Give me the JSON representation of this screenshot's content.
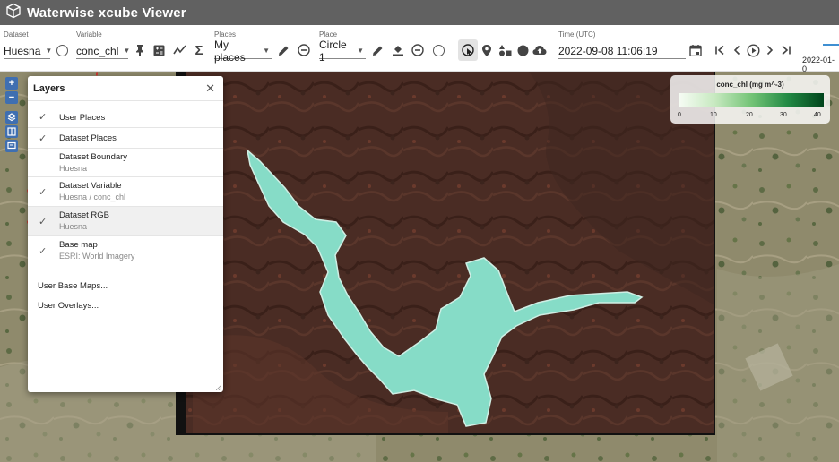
{
  "app": {
    "title": "Waterwise xcube Viewer"
  },
  "toolbar": {
    "dataset": {
      "label": "Dataset",
      "value": "Huesna"
    },
    "variable": {
      "label": "Variable",
      "value": "conc_chl"
    },
    "places": {
      "label": "Places",
      "value": "My places"
    },
    "place": {
      "label": "Place",
      "value": "Circle 1"
    },
    "time": {
      "label": "Time (UTC)",
      "value": "2022-09-08 11:06:19"
    },
    "timeline_start": "2022-01-0"
  },
  "layers_panel": {
    "title": "Layers",
    "items": [
      {
        "label": "User Places",
        "sub": "",
        "checked": true
      },
      {
        "label": "Dataset Places",
        "sub": "",
        "checked": true
      },
      {
        "label": "Dataset Boundary",
        "sub": "Huesna",
        "checked": false
      },
      {
        "label": "Dataset Variable",
        "sub": "Huesna / conc_chl",
        "checked": true
      },
      {
        "label": "Dataset RGB",
        "sub": "Huesna",
        "checked": true
      },
      {
        "label": "Base map",
        "sub": "ESRI: World Imagery",
        "checked": true
      }
    ],
    "links": [
      "User Base Maps...",
      "User Overlays..."
    ]
  },
  "legend": {
    "title": "conc_chl (mg m^-3)",
    "ticks": [
      "0",
      "10",
      "20",
      "30",
      "40"
    ],
    "colors": [
      "#f7fcf5",
      "#c7e9c0",
      "#74c476",
      "#238b45",
      "#00441b"
    ]
  },
  "colors": {
    "appbar": "#616161",
    "accent": "#3f6fb1",
    "water": "#7fd8c4",
    "annotation": "#e02020"
  }
}
